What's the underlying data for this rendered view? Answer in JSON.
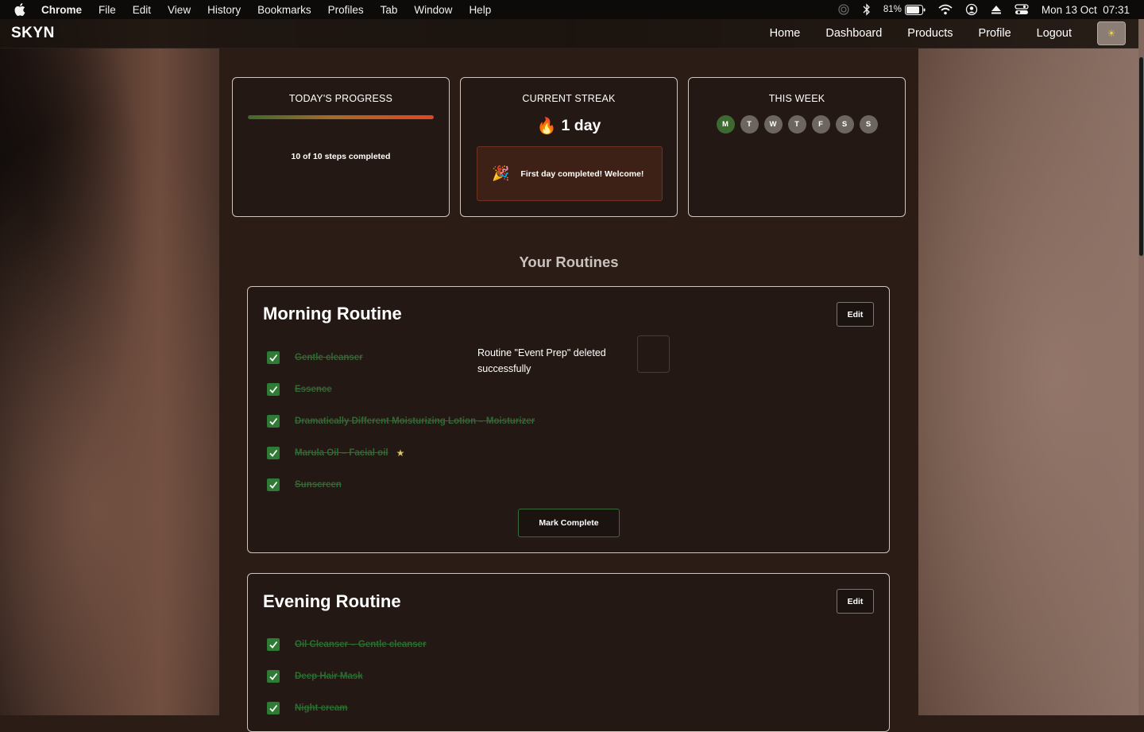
{
  "menubar": {
    "app_name": "Chrome",
    "menus": [
      "File",
      "Edit",
      "View",
      "History",
      "Bookmarks",
      "Profiles",
      "Tab",
      "Window",
      "Help"
    ],
    "battery": "81%",
    "datetime": "Mon 13 Oct  07:31"
  },
  "site": {
    "brand": "SKYN",
    "nav": [
      "Home",
      "Dashboard",
      "Products",
      "Profile",
      "Logout"
    ],
    "theme_icon": "sun-icon"
  },
  "progress_card": {
    "title": "TODAY'S PROGRESS",
    "completed": 10,
    "total": 10,
    "fraction": 1.0,
    "text": "10 of 10 steps completed"
  },
  "streak_card": {
    "title": "CURRENT STREAK",
    "value": "1 day",
    "message": "First day completed! Welcome!"
  },
  "week_card": {
    "title": "THIS WEEK",
    "days": [
      {
        "label": "M",
        "done": true
      },
      {
        "label": "T",
        "done": false
      },
      {
        "label": "W",
        "done": false
      },
      {
        "label": "T",
        "done": false
      },
      {
        "label": "F",
        "done": false
      },
      {
        "label": "S",
        "done": false
      },
      {
        "label": "S",
        "done": false
      }
    ]
  },
  "routines_title": "Your Routines",
  "morning": {
    "title": "Morning Routine",
    "edit_label": "Edit",
    "steps": [
      "Gentle cleanser",
      "Essence",
      "Dramatically Different Moisturizing Lotion – Moisturizer",
      "Marula Oil – Facial oil",
      "Sunscreen"
    ],
    "mark_complete_label": "Mark Complete"
  },
  "toast": {
    "message": "Routine \"Event Prep\" deleted successfully"
  },
  "evening": {
    "title": "Evening Routine",
    "edit_label": "Edit",
    "steps": [
      "Oil Cleanser – Gentle cleanser",
      "Deep Hair Mask",
      "Night cream"
    ]
  },
  "colors": {
    "accent_green": "#2f7a34",
    "card_bg": "#231813",
    "page_bg": "#2b1d16"
  }
}
